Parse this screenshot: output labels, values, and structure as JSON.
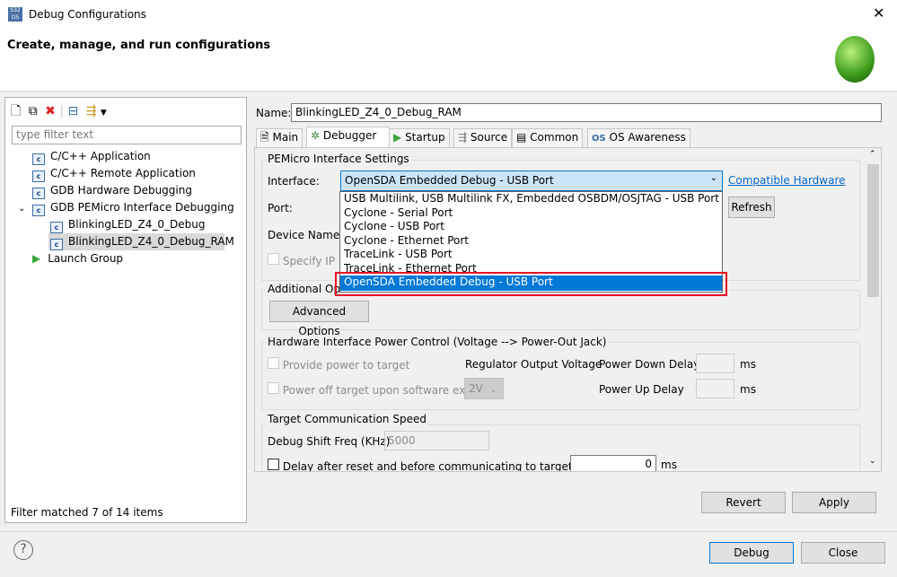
{
  "window": {
    "title": "Debug Configurations",
    "header": "Create, manage, and run configurations"
  },
  "left": {
    "filter_placeholder": "type filter text",
    "items": [
      {
        "label": "C/C++ Application"
      },
      {
        "label": "C/C++ Remote Application"
      },
      {
        "label": "GDB Hardware Debugging"
      },
      {
        "label": "GDB PEMicro Interface Debugging",
        "expanded": true
      },
      {
        "label": "BlinkingLED_Z4_0_Debug"
      },
      {
        "label": "BlinkingLED_Z4_0_Debug_RAM",
        "selected": true
      },
      {
        "label": "Launch Group"
      }
    ],
    "status": "Filter matched 7 of 14 items"
  },
  "name": {
    "label": "Name:",
    "value": "BlinkingLED_Z4_0_Debug_RAM"
  },
  "tabs": [
    {
      "label": "Main"
    },
    {
      "label": "Debugger",
      "active": true
    },
    {
      "label": "Startup"
    },
    {
      "label": "Source"
    },
    {
      "label": "Common"
    },
    {
      "label": "OS Awareness"
    }
  ],
  "pemicro": {
    "title": "PEMicro Interface Settings",
    "interface_label": "Interface:",
    "interface_value": "OpenSDA Embedded Debug - USB Port",
    "compatible_link": "Compatible Hardware",
    "port_label": "Port:",
    "refresh": "Refresh",
    "device_label": "Device Name:",
    "specify_ip": "Specify IP",
    "options": [
      "USB Multilink, USB Multilink FX, Embedded OSBDM/OSJTAG - USB Port",
      "Cyclone - Serial Port",
      "Cyclone - USB Port",
      "Cyclone - Ethernet Port",
      "TraceLink - USB Port",
      "TraceLink - Ethernet Port",
      "OpenSDA Embedded Debug - USB Port"
    ]
  },
  "additional": {
    "title": "Additional Options",
    "button": "Advanced Options"
  },
  "power": {
    "title": "Hardware Interface Power Control (Voltage --> Power-Out Jack)",
    "provide": "Provide power to target",
    "poweroff": "Power off target upon software exit",
    "regulator": "Regulator Output Voltage",
    "voltage": "2V",
    "down": "Power Down Delay",
    "up": "Power Up Delay",
    "ms": "ms"
  },
  "speed": {
    "title": "Target Communication Speed",
    "freq_label": "Debug Shift Freq (KHz)",
    "freq_value": "5000",
    "delay_label": "Delay after reset and before communicating to target for",
    "delay_value": "0",
    "ms": "ms"
  },
  "buttons": {
    "revert": "Revert",
    "apply": "Apply",
    "debug": "Debug",
    "close": "Close"
  },
  "colors": {
    "selection": "#0078d7",
    "highlight_box": "#e81123",
    "link": "#0066cc"
  }
}
